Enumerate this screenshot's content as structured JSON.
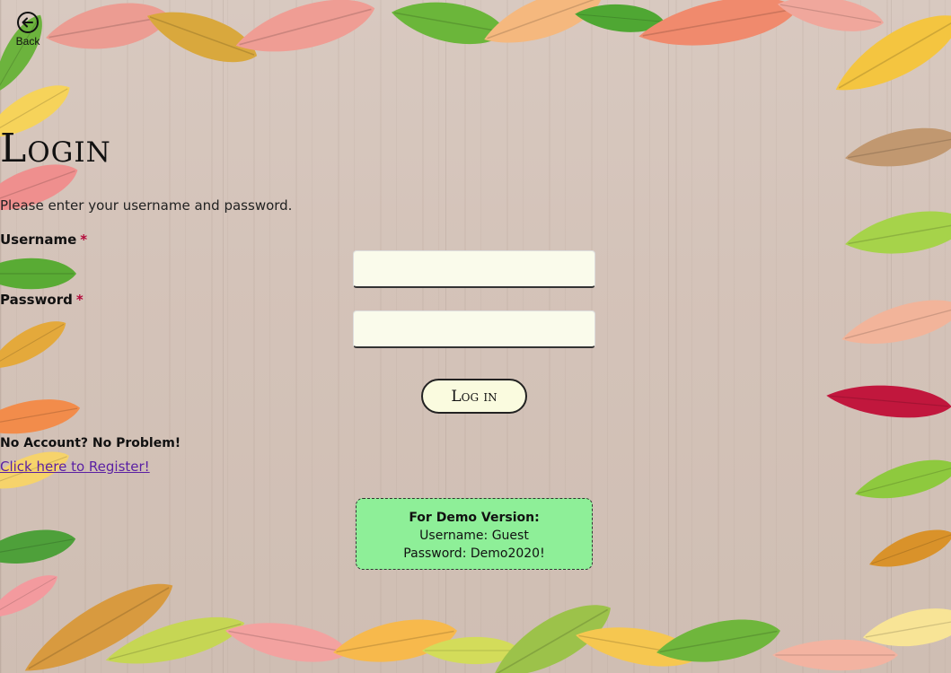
{
  "nav": {
    "back_icon": "arrow-left-circle-icon",
    "back_label": "Back"
  },
  "login": {
    "title": "Login",
    "instructions": "Please enter your username and password.",
    "username_label": "Username",
    "password_label": "Password",
    "required_marker": "*",
    "username_value": "",
    "password_value": "",
    "submit_label": "Log in"
  },
  "register": {
    "prompt": "No Account? No Problem!",
    "link_label": "Click here to Register!"
  },
  "demo": {
    "heading": "For Demo Version:",
    "username_line": "Username: Guest",
    "password_line": "Password: Demo2020!"
  },
  "colors": {
    "required": "#b3093a",
    "link": "#5a1fa3",
    "demo_background": "#8eef98",
    "input_background": "#fafbeb"
  }
}
